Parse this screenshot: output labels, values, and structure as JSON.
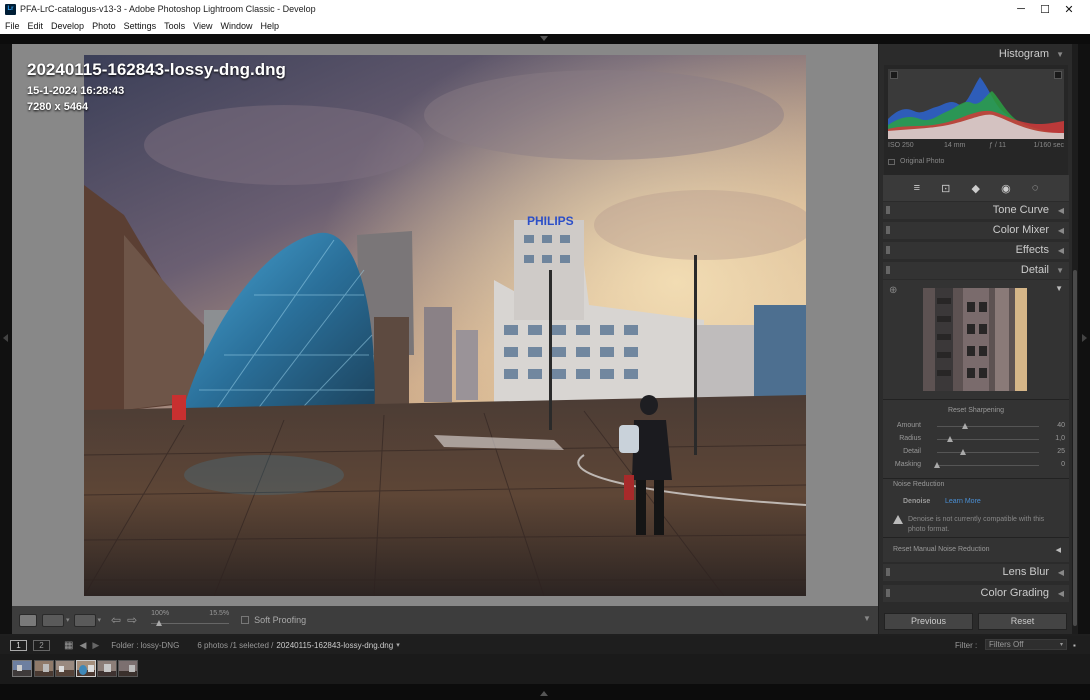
{
  "window": {
    "title": "PFA-LrC-catalogus-v13-3 - Adobe Photoshop Lightroom Classic - Develop",
    "app_icon": "Lr",
    "controls": {
      "minimize": "─",
      "maximize": "☐",
      "close": "✕"
    }
  },
  "menu": [
    "File",
    "Edit",
    "Develop",
    "Photo",
    "Settings",
    "Tools",
    "View",
    "Window",
    "Help"
  ],
  "photo": {
    "filename": "20240115-162843-lossy-dng.dng",
    "datetime": "15-1-2024 16:28:43",
    "dimensions": "7280 x 5464",
    "sign_text": "PHILIPS"
  },
  "toolbar": {
    "zoom_left": "100%",
    "zoom_right": "15.5%",
    "soft_proofing": "Soft Proofing"
  },
  "histogram": {
    "title": "Histogram",
    "iso": "ISO 250",
    "focal": "14 mm",
    "aperture": "ƒ / 11",
    "shutter": "1/160 sec",
    "original_photo": "Original Photo"
  },
  "panels": {
    "tone_curve": "Tone Curve",
    "color_mixer": "Color Mixer",
    "effects": "Effects",
    "detail": "Detail",
    "lens_blur": "Lens Blur",
    "color_grading": "Color Grading"
  },
  "sharpening": {
    "reset": "Reset Sharpening",
    "sliders": [
      {
        "label": "Amount",
        "value": "40",
        "level": 0.27
      },
      {
        "label": "Radius",
        "value": "1,0",
        "level": 0.13
      },
      {
        "label": "Detail",
        "value": "25",
        "level": 0.25
      },
      {
        "label": "Masking",
        "value": "0",
        "level": 0.0
      }
    ]
  },
  "noise": {
    "title": "Noise Reduction",
    "denoise": "Denoise",
    "learn_more": "Learn More",
    "warning": "Denoise is not currently compatible with this photo format.",
    "reset_manual": "Reset Manual Noise Reduction"
  },
  "buttons": {
    "previous": "Previous",
    "reset": "Reset"
  },
  "filmstrip": {
    "monitor1": "1",
    "monitor2": "2",
    "folder": "Folder : lossy-DNG",
    "count": "6 photos /1 selected /",
    "current": "20240115-162843-lossy-dng.dng",
    "filter_label": "Filter :",
    "filter_value": "Filters Off"
  },
  "colors": {
    "accent": "#4a8fd4",
    "panel_bg": "#2b2b2b",
    "canvas_bg": "#888888"
  }
}
